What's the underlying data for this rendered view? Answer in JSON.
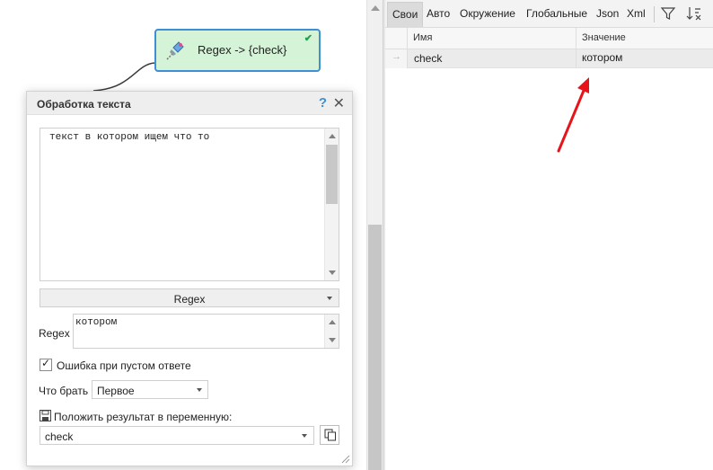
{
  "node": {
    "title": "Regex -> {check}"
  },
  "dialog": {
    "title": "Обработка текста",
    "help": "?",
    "close": "✕",
    "input_text": "текст в котором ищем что то",
    "mode": "Regex",
    "regex_label": "Regex",
    "regex_value": "котором",
    "error_on_empty_label": "Ошибка при пустом ответе",
    "error_on_empty_checked": true,
    "take_label": "Что брать",
    "take_value": "Первое",
    "save_label": "Положить результат в переменную:",
    "variable_value": "check"
  },
  "panel": {
    "tabs": [
      {
        "label": "Свои",
        "active": true
      },
      {
        "label": "Авто"
      },
      {
        "label": "Окружение"
      },
      {
        "label": "Глобальные"
      },
      {
        "label": "Json"
      },
      {
        "label": "Xml"
      }
    ],
    "columns": [
      "Имя",
      "Значение"
    ],
    "rows": [
      {
        "name": "check",
        "value": "котором"
      }
    ]
  },
  "colors": {
    "node_bg": "#d5f3d7",
    "node_border": "#3f8fd4",
    "accent_blue": "#3f8fd4",
    "annotation_red": "#e8141b"
  }
}
